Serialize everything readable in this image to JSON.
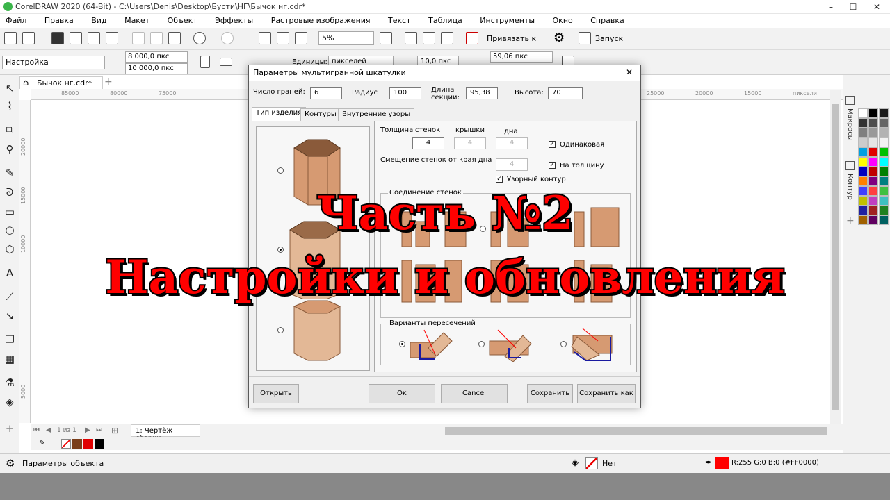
{
  "window": {
    "title": "CorelDRAW 2020 (64-Bit) - C:\\Users\\Denis\\Desktop\\Бусти\\НГ\\Бычок нг.cdr*",
    "min": "–",
    "max": "☐",
    "close": "✕"
  },
  "menu": [
    "Файл",
    "Правка",
    "Вид",
    "Макет",
    "Объект",
    "Эффекты",
    "Растровые изображения",
    "Текст",
    "Таблица",
    "Инструменты",
    "Окно",
    "Справка"
  ],
  "toolbar1": {
    "zoom": "5%",
    "snap_label": "Привязать к",
    "launch_label": "Запуск"
  },
  "toolbar2": {
    "preset": "Настройка",
    "width": "8 000,0 пкс",
    "height": "10 000,0 пкс",
    "units_label": "Единицы:",
    "units": "пикселей",
    "nudge": "10,0 пкс",
    "dup": "59,06 пкс"
  },
  "document": {
    "tab": "Бычок нг.cdr*",
    "ruler_unit": "пиксели",
    "ruler_h": [
      "85000",
      "80000",
      "75000",
      "25000",
      "20000",
      "15000"
    ],
    "ruler_v": [
      "20000",
      "15000",
      "10000",
      "5000"
    ]
  },
  "dialog": {
    "title": "Параметры мультигранной шкатулки",
    "faces_label": "Число граней:",
    "faces": "6",
    "radius_label": "Радиус",
    "radius": "100",
    "section_label": "Длина секции:",
    "section": "95,38",
    "height_label": "Высота:",
    "height": "70",
    "tabs": [
      "Тип изделия",
      "Контуры",
      "Внутренние узоры"
    ],
    "thickness_label": "Толщина",
    "walls_label": "стенок",
    "walls": "4",
    "lid_label": "крышки",
    "lid": "4",
    "bottom_label": "дна",
    "bottom": "4",
    "same_label": "Одинаковая",
    "offset_label": "Смещение стенок от края дна",
    "offset": "4",
    "on_thickness_label": "На толщину",
    "pattern_label": "Узорный контур",
    "joint_group": "Соединение стенок",
    "cross_group": "Варианты пересечений",
    "buttons": {
      "open": "Открыть",
      "ok": "Ок",
      "cancel": "Cancel",
      "save": "Сохранить",
      "save_as": "Сохранить как"
    },
    "close": "✕"
  },
  "overlay": {
    "line1": "Часть №2",
    "line2": "Настройки и обновления"
  },
  "dock": {
    "macros": "Макросы",
    "contour": "Контур"
  },
  "pagebar": {
    "page_of": "1 из 1",
    "page_tab": "1: Чертёж сборки"
  },
  "status": {
    "props": "Параметры объекта",
    "fill_none": "Нет",
    "color": "R:255 G:0 B:0 (#FF0000)"
  },
  "colors": {
    "accent": "#ff0000",
    "wood": "#d69a72",
    "wood_dark": "#8a5a3a"
  }
}
